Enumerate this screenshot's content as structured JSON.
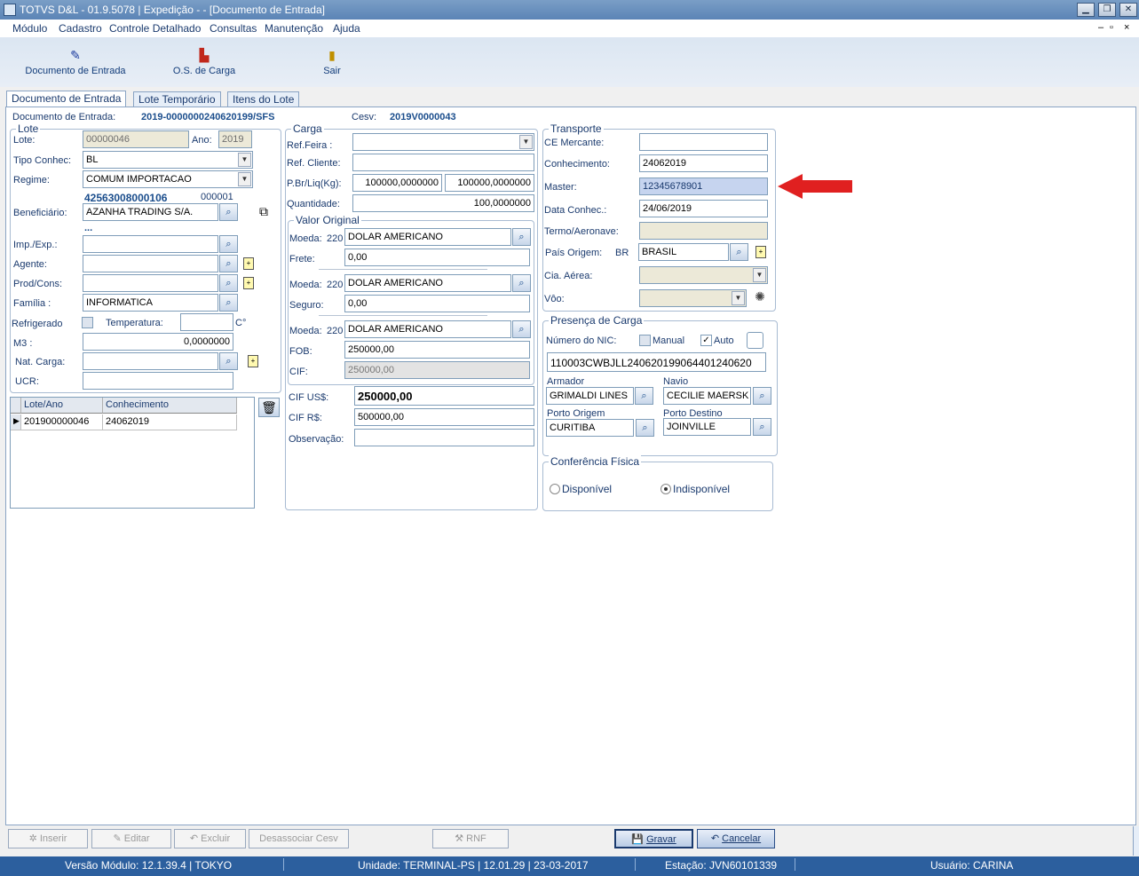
{
  "window": {
    "title": "TOTVS D&L - 01.9.5078 | Expedição - - [Documento de Entrada]"
  },
  "menu": [
    "Módulo",
    "Cadastro",
    "Controle Detalhado",
    "Consultas",
    "Manutenção",
    "Ajuda"
  ],
  "toolbar": {
    "doc_entrada": "Documento de Entrada",
    "os_carga": "O.S. de Carga",
    "sair": "Sair"
  },
  "tabs": [
    "Documento de Entrada",
    "Lote Temporário",
    "Itens do Lote"
  ],
  "header": {
    "doc_label": "Documento de Entrada:",
    "doc_value": "2019-0000000240620199/SFS",
    "cesv_label": "Cesv:",
    "cesv_value": "2019V0000043"
  },
  "lote": {
    "title": "Lote",
    "lote_label": "Lote:",
    "lote_value": "00000046",
    "ano_label": "Ano:",
    "ano_value": "2019",
    "tipo_label": "Tipo Conhec:",
    "tipo_value": "BL",
    "regime_label": "Regime:",
    "regime_value": "COMUM IMPORTACAO",
    "cnpj": "42563008000106",
    "cnpj_suffix": "000001",
    "benef_label": "Beneficiário:",
    "benef_value": "AZANHA TRADING S/A.",
    "dots": "...",
    "imp_label": "Imp./Exp.:",
    "agente_label": "Agente:",
    "prod_label": "Prod/Cons:",
    "familia_label": "Família :",
    "familia_value": "INFORMATICA",
    "refrig_label": "Refrigerado",
    "temp_label": "Temperatura:",
    "temp_unit": "C°",
    "m3_label": "M3  :",
    "m3_value": "0,0000000",
    "nat_label": "Nat. Carga:",
    "ucr_label": "UCR:"
  },
  "grid": {
    "headers": [
      "Lote/Ano",
      "Conhecimento"
    ],
    "rows": [
      [
        "201900000046",
        "24062019"
      ]
    ]
  },
  "carga": {
    "title": "Carga",
    "feira_label": "Ref.Feira :",
    "cliente_label": "Ref. Cliente:",
    "pbr_label": "P.Br/Liq(Kg):",
    "pbr_value": "100000,0000000",
    "pliq_value": "100000,0000000",
    "qtd_label": "Quantidade:",
    "qtd_value": "100,0000000",
    "vo_title": "Valor Original",
    "moeda_label": "Moeda:",
    "moeda_code": "220",
    "moeda_value": "DOLAR AMERICANO",
    "frete_label": "Frete:",
    "frete_value": "0,00",
    "seguro_label": "Seguro:",
    "seguro_value": "0,00",
    "fob_label": "FOB:",
    "fob_value": "250000,00",
    "cif_label": "CIF:",
    "cif_value": "250000,00",
    "cifus_label": "CIF  US$:",
    "cifus_value": "250000,00",
    "cifrs_label": "CIF  R$:",
    "cifrs_value": "500000,00",
    "obs_label": "Observação:"
  },
  "transporte": {
    "title": "Transporte",
    "ce_label": "CE Mercante:",
    "conh_label": "Conhecimento:",
    "conh_value": "24062019",
    "master_label": "Master:",
    "master_value": "12345678901",
    "data_label": "Data Conhec.:",
    "data_value": "24/06/2019",
    "termo_label": "Termo/Aeronave:",
    "pais_label": "País Origem:",
    "pais_code": "BR",
    "pais_value": "BRASIL",
    "cia_label": "Cia. Aérea:",
    "voo_label": "Vôo:"
  },
  "presenca": {
    "title": "Presença de Carga",
    "nic_label": "Número do NIC:",
    "manual_label": "Manual",
    "auto_label": "Auto",
    "nic_value": "110003CWBJLL240620199064401240620",
    "armador_label": "Armador",
    "armador_value": "GRIMALDI LINES",
    "navio_label": "Navio",
    "navio_value": "CECILIE MAERSK",
    "porig_label": "Porto Origem",
    "porig_value": "CURITIBA",
    "pdest_label": "Porto Destino",
    "pdest_value": "JOINVILLE"
  },
  "conferencia": {
    "title": "Conferência Física",
    "disp": "Disponível",
    "indisp": "Indisponível"
  },
  "buttons": {
    "inserir": "Inserir",
    "editar": "Editar",
    "excluir": "Excluir",
    "desassociar": "Desassociar Cesv",
    "rnf": "RNF",
    "gravar": "Gravar",
    "cancelar": "Cancelar"
  },
  "status": {
    "versao": "Versão Módulo:  12.1.39.4  |  TOKYO",
    "unidade": "Unidade: TERMINAL-PS | 12.01.29 | 23-03-2017",
    "estacao": "Estação: JVN60101339",
    "usuario": "Usuário: CARINA"
  },
  "colors": {
    "accent": "#1a3a6e",
    "arrow": "#e02020",
    "status": "#2c5f9e"
  }
}
